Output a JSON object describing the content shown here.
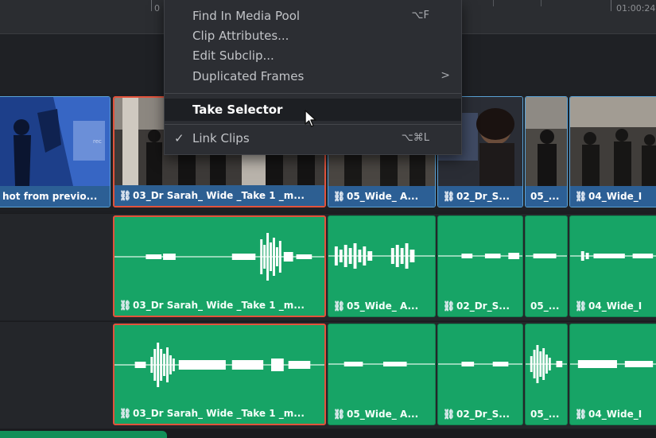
{
  "ruler": {
    "left_timecode": "0",
    "right_timecode": "01:00:24"
  },
  "context_menu": {
    "items": [
      {
        "label": "Find In Media Pool",
        "shortcut": "⌥F",
        "has_submenu": false,
        "checked": false,
        "highlighted": false
      },
      {
        "label": "Clip Attributes...",
        "shortcut": "",
        "has_submenu": false,
        "checked": false,
        "highlighted": false
      },
      {
        "label": "Edit Subclip...",
        "shortcut": "",
        "has_submenu": false,
        "checked": false,
        "highlighted": false
      },
      {
        "label": "Duplicated Frames",
        "shortcut": "",
        "has_submenu": true,
        "checked": false,
        "highlighted": false
      },
      {
        "label": "Take Selector",
        "shortcut": "",
        "has_submenu": false,
        "checked": false,
        "highlighted": true
      },
      {
        "label": "Link Clips",
        "shortcut": "⌥⌘L",
        "has_submenu": false,
        "checked": true,
        "highlighted": false
      }
    ],
    "submenu_glyph": ">",
    "check_glyph": "✓"
  },
  "video_track": {
    "clips": [
      {
        "label": "hot from previo...",
        "linked": false,
        "selected": false
      },
      {
        "label": "03_Dr Sarah_ Wide _Take 1 _m...",
        "linked": true,
        "selected": true
      },
      {
        "label": "05_Wide_ A...",
        "linked": true,
        "selected": false
      },
      {
        "label": "02_Dr_S...",
        "linked": true,
        "selected": false
      },
      {
        "label": "05_...",
        "linked": false,
        "selected": false
      },
      {
        "label": "04_Wide_I",
        "linked": true,
        "selected": false
      }
    ]
  },
  "audio_tracks": [
    {
      "clips": [
        {
          "label": "03_Dr Sarah_ Wide _Take 1 _m...",
          "selected": true
        },
        {
          "label": "05_Wide_ A...",
          "selected": false
        },
        {
          "label": "02_Dr_S...",
          "selected": false
        },
        {
          "label": "05_...",
          "selected": false
        },
        {
          "label": "04_Wide_I",
          "selected": false
        }
      ]
    },
    {
      "clips": [
        {
          "label": "03_Dr Sarah_ Wide _Take 1 _m...",
          "selected": true
        },
        {
          "label": "05_Wide_ A...",
          "selected": false
        },
        {
          "label": "02_Dr_S...",
          "selected": false
        },
        {
          "label": "05_...",
          "selected": false
        },
        {
          "label": "04_Wide_I",
          "selected": false
        }
      ]
    }
  ],
  "icons": {
    "link": "link-icon",
    "check": "check-icon",
    "submenu": "chevron-right-icon",
    "cursor": "mouse-pointer-icon"
  },
  "colors": {
    "video_label_bg": "#2c5f95",
    "audio_clip_bg": "#17a466",
    "selection_outline": "#e2533c",
    "video_outline": "#5aa2d6"
  }
}
